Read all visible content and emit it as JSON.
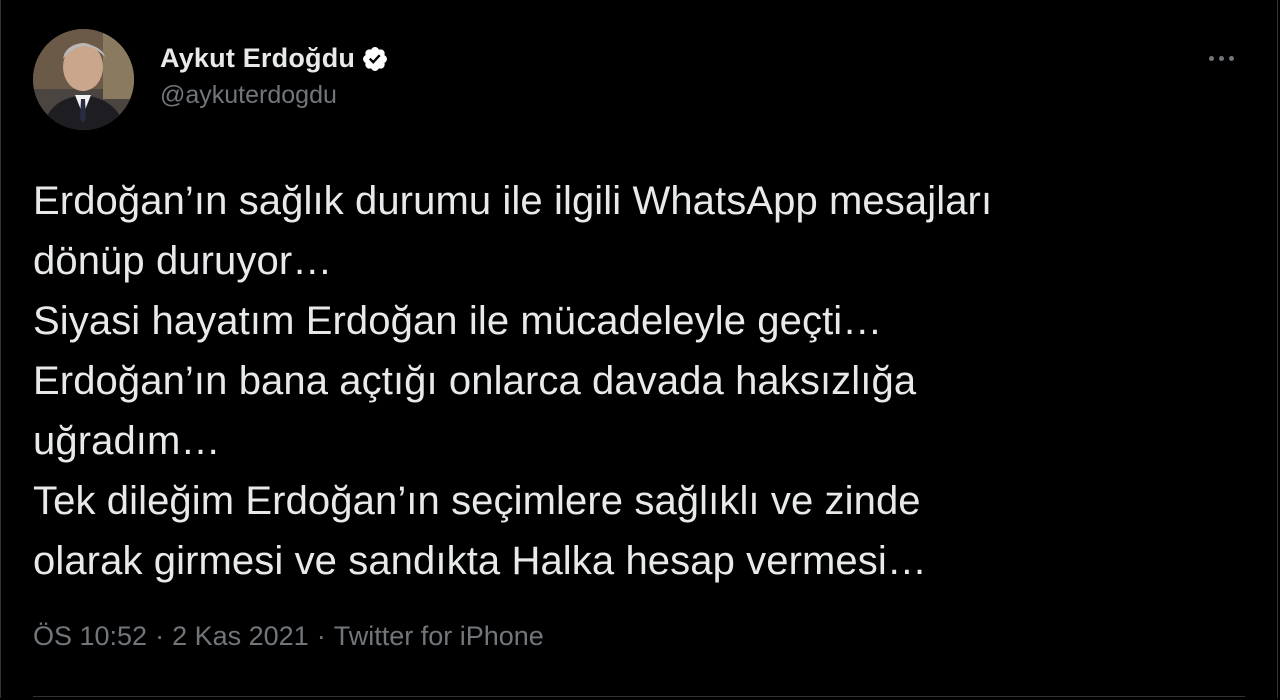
{
  "tweet": {
    "author": {
      "display_name": "Aykut Erdoğdu",
      "handle": "@aykuterdogdu",
      "verified": true,
      "avatar_icon": "profile-photo"
    },
    "more_icon": "more-horizontal-icon",
    "text_lines": [
      "Erdoğan’ın sağlık durumu ile ilgili WhatsApp mesajları",
      "dönüp duruyor…",
      "Siyasi hayatım Erdoğan ile mücadeleyle geçti…",
      "Erdoğan’ın bana açtığı onlarca davada haksızlığa",
      "uğradım…",
      "Tek dileğim Erdoğan’ın seçimlere sağlıklı ve zinde",
      "olarak girmesi ve sandıkta Halka hesap vermesi…"
    ],
    "meta": {
      "time": "ÖS 10:52",
      "date": "2 Kas 2021",
      "separator": "·",
      "source": "Twitter for iPhone"
    }
  },
  "colors": {
    "background": "#000000",
    "text": "#e7e9ea",
    "secondary": "#71767b",
    "verified_badge": "#ffffff",
    "divider": "#2f3336"
  }
}
